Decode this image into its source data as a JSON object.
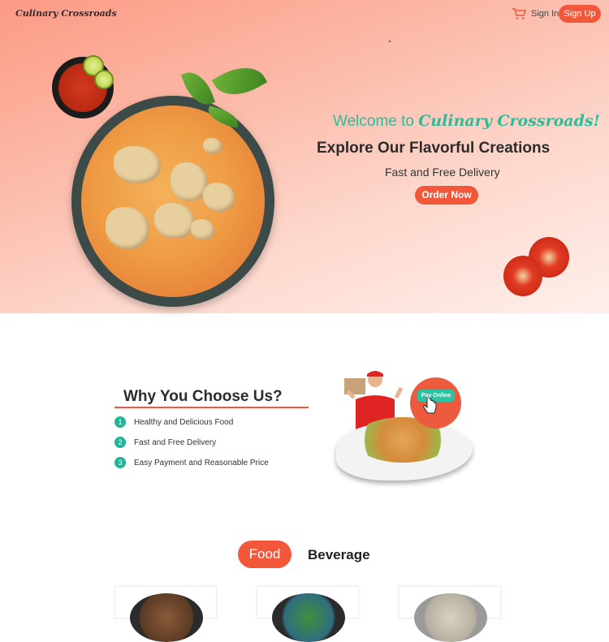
{
  "nav": {
    "logo": "Culinary Crossroads",
    "cart_icon": "cart-icon",
    "sign_in": "Sign In",
    "sign_up": "Sign Up"
  },
  "hero": {
    "welcome_prefix": "Welcome to ",
    "welcome_brand": "Culinary Crossroads!",
    "title": "Explore Our Flavorful Creations",
    "subtitle": "Fast and Free Delivery",
    "cta": "Order Now"
  },
  "why": {
    "title": "Why You Choose Us?",
    "items": [
      {
        "num": "1",
        "label": "Healthy and Delicious Food"
      },
      {
        "num": "2",
        "label": "Fast and Free Delivery"
      },
      {
        "num": "3",
        "label": "Easy Payment and Reasonable Price"
      }
    ],
    "pay_button": "Pay Online"
  },
  "menu": {
    "tabs": [
      {
        "label": "Food",
        "active": true
      },
      {
        "label": "Beverage",
        "active": false
      }
    ]
  },
  "colors": {
    "accent": "#f3573a",
    "teal": "#2dbb9a"
  }
}
